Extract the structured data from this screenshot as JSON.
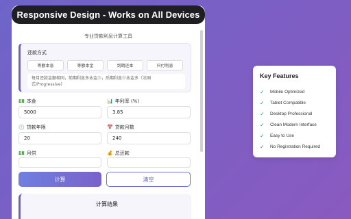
{
  "banner": {
    "title": "Responsive Design - Works on All Devices"
  },
  "app": {
    "subtitle": "专业贷款利息计算工具",
    "method": {
      "title": "还款方式",
      "options": [
        "等额本息",
        "等额本金",
        "到期还本",
        "只付利息"
      ],
      "note": "每月还款金额相同，前期利息多本金少，后期利息少本金多（法国式/Progressive）"
    },
    "fields": {
      "principal": {
        "label": "本金",
        "icon": "money-icon",
        "value": "5000"
      },
      "rate": {
        "label": "年利率 (%)",
        "icon": "chart-icon",
        "value": "3.85"
      },
      "years": {
        "label": "贷款年限",
        "icon": "clock-icon",
        "value": "20"
      },
      "months": {
        "label": "贷款月数",
        "icon": "calendar-icon",
        "value": "240"
      },
      "monthly": {
        "label": "月供",
        "icon": "money-icon",
        "value": ""
      },
      "total": {
        "label": "总还款",
        "icon": "bag-icon",
        "value": ""
      }
    },
    "buttons": {
      "calculate": "计算",
      "clear": "清空"
    },
    "result": {
      "title": "计算结果"
    }
  },
  "features": {
    "title": "Key Features",
    "items": [
      "Mobile Optimized",
      "Tablet Compatible",
      "Desktop Professional",
      "Clean Modern Interface",
      "Easy to Use",
      "No Registration Required"
    ]
  },
  "colors": {
    "accent": "#6c5ecf",
    "check": "#22a06b",
    "banner": "#1f1f23"
  }
}
